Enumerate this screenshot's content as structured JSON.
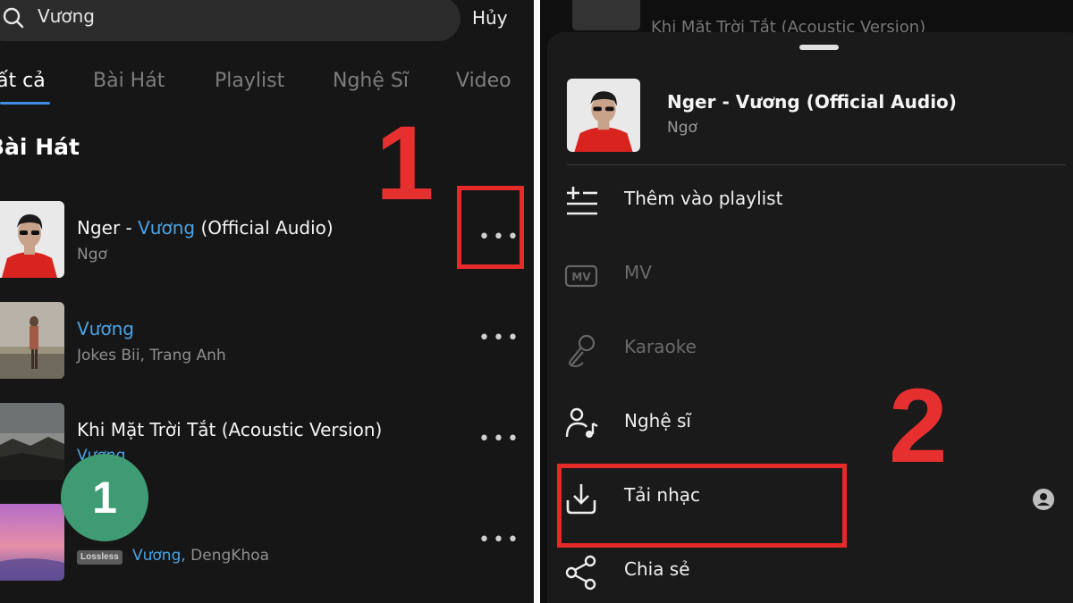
{
  "search": {
    "query": "Vương",
    "cancel_label": "Hủy"
  },
  "tabs": [
    {
      "label": "ất cả",
      "active": true
    },
    {
      "label": "Bài Hát"
    },
    {
      "label": "Playlist"
    },
    {
      "label": "Nghệ Sĩ"
    },
    {
      "label": "Video"
    }
  ],
  "section_title": "Bài Hát",
  "songs": [
    {
      "title_pre": "Nger - ",
      "title_hl": "Vương",
      "title_post": " (Official Audio)",
      "artist": "Ngơ"
    },
    {
      "title_pre": "",
      "title_hl": "Vương",
      "title_post": "",
      "artist": "Jokes Bii, Trang Anh"
    },
    {
      "title_pre": "Khi Mặt Trời Tắt (Acoustic Version)",
      "title_hl": "",
      "title_post": "",
      "artist_hl": "Vương"
    },
    {
      "title_pre": "",
      "title_hl": "",
      "title_post": "",
      "badge": "Lossless",
      "artist_hl": "Vương,",
      "artist": " DengKhoa"
    }
  ],
  "annotations": {
    "step1": "1",
    "step2": "2",
    "green_badge": "1"
  },
  "sheet": {
    "bg_peek_title": "Khi Mặt Trời Tắt (Acoustic Version)",
    "song_title": "Nger - Vương (Official Audio)",
    "song_artist": "Ngơ",
    "menu": [
      {
        "label": "Thêm vào playlist",
        "icon": "add-to-playlist-icon"
      },
      {
        "label": "MV",
        "icon": "mv-icon",
        "disabled": true
      },
      {
        "label": "Karaoke",
        "icon": "microphone-icon",
        "disabled": true
      },
      {
        "label": "Nghệ sĩ",
        "icon": "artist-icon"
      },
      {
        "label": "Tải nhạc",
        "icon": "download-icon"
      },
      {
        "label": "Chia sẻ",
        "icon": "share-icon"
      }
    ]
  },
  "colors": {
    "accent": "#4aa3e6",
    "annotation_red": "#e52a2a",
    "badge_green": "#3f9b74"
  }
}
